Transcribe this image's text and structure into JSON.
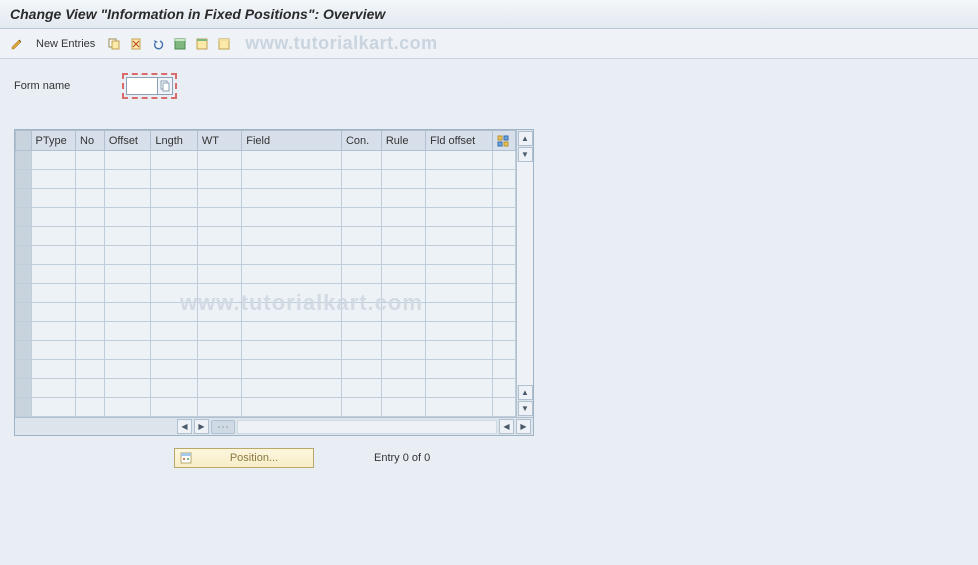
{
  "title": "Change View \"Information in Fixed Positions\": Overview",
  "toolbar": {
    "new_entries": "New Entries"
  },
  "watermark": "www.tutorialkart.com",
  "form": {
    "name_label": "Form name",
    "name_value": ""
  },
  "table": {
    "columns": [
      "PType",
      "No",
      "Offset",
      "Lngth",
      "WT",
      "Field",
      "Con.",
      "Rule",
      "Fld offset"
    ]
  },
  "footer": {
    "position_label": "Position...",
    "entry_text": "Entry 0 of 0"
  }
}
